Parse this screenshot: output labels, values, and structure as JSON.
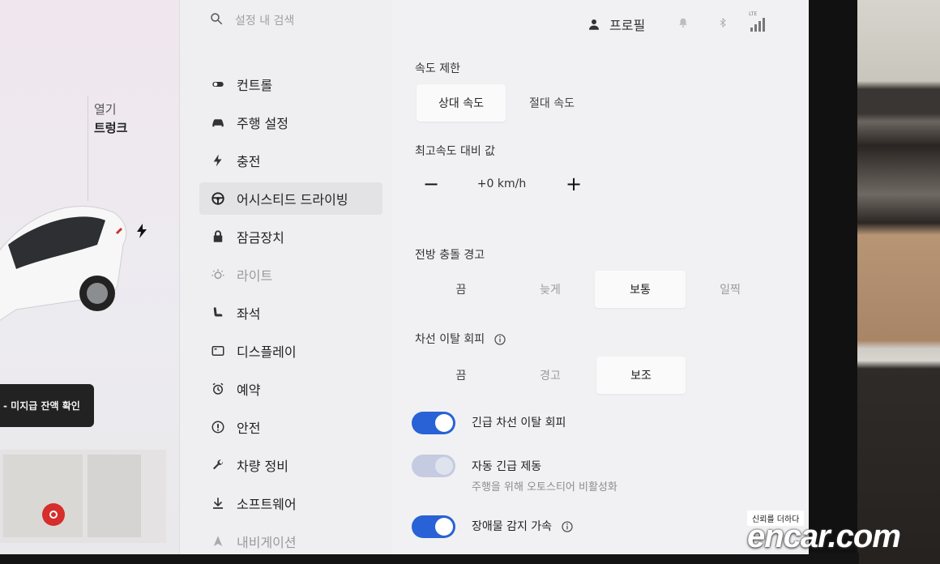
{
  "search": {
    "placeholder": "설정 내 검색"
  },
  "status_bar": {
    "profile_label": "프로필",
    "network_label": "LTE"
  },
  "left_panel": {
    "open_label": "열기",
    "trunk_label": "트렁크",
    "alert_text": "- 미지급 잔액 확인"
  },
  "menu": {
    "items": [
      {
        "label": "컨트롤",
        "icon": "toggle-icon"
      },
      {
        "label": "주행 설정",
        "icon": "car-icon"
      },
      {
        "label": "충전",
        "icon": "bolt-icon"
      },
      {
        "label": "어시스티드 드라이빙",
        "icon": "steering-wheel-icon",
        "active": true
      },
      {
        "label": "잠금장치",
        "icon": "lock-icon"
      },
      {
        "label": "라이트",
        "icon": "light-icon"
      },
      {
        "label": "좌석",
        "icon": "seat-icon"
      },
      {
        "label": "디스플레이",
        "icon": "display-icon"
      },
      {
        "label": "예약",
        "icon": "alarm-icon"
      },
      {
        "label": "안전",
        "icon": "info-circle-icon"
      },
      {
        "label": "차량 정비",
        "icon": "wrench-icon"
      },
      {
        "label": "소프트웨어",
        "icon": "download-icon"
      },
      {
        "label": "내비게이션",
        "icon": "navigation-icon"
      }
    ]
  },
  "content": {
    "speed_limit": {
      "title": "속도 제한",
      "options": [
        "상대 속도",
        "절대 속도"
      ],
      "selected": "상대 속도"
    },
    "speed_offset": {
      "title": "최고속도 대비 값",
      "value": "+0 km/h",
      "minus": "−",
      "plus": "+"
    },
    "forward_collision": {
      "title": "전방 충돌 경고",
      "options": [
        "끔",
        "늦게",
        "보통",
        "일찍"
      ],
      "selected": "보통"
    },
    "lane_departure": {
      "title": "차선 이탈 회피",
      "options": [
        "끔",
        "경고",
        "보조"
      ],
      "selected": "보조"
    },
    "toggles": [
      {
        "label": "긴급 차선 이탈 회피",
        "on": true
      },
      {
        "label": "자동 긴급 제동",
        "sub": "주행을 위해 오토스티어 비활성화",
        "on": true,
        "disabled": true
      },
      {
        "label": "장애물 감지 가속",
        "on": true
      }
    ]
  },
  "watermark": {
    "tag": "신뢰를 더하다",
    "logo": "encar.com"
  },
  "colors": {
    "accent": "#2862d6",
    "alert_bg": "#222222",
    "record": "#d62d2d"
  }
}
